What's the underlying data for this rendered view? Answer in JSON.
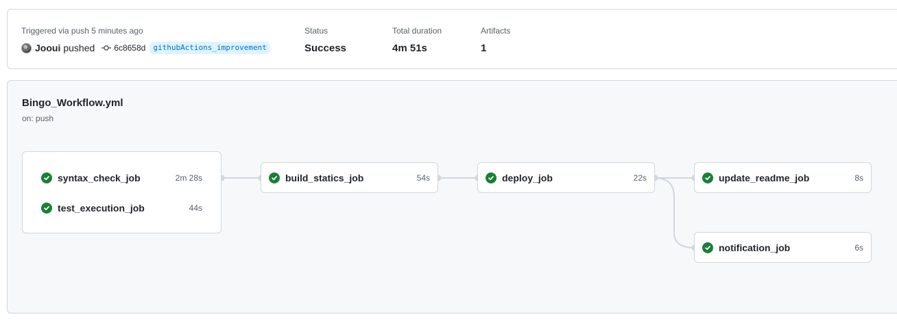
{
  "summary": {
    "trigger_text": "Triggered via push 5 minutes ago",
    "actor": "Jooui",
    "action": "pushed",
    "commit_sha": "6c8658d",
    "branch": "githubActions_improvement",
    "status_label": "Status",
    "status_value": "Success",
    "duration_label": "Total duration",
    "duration_value": "4m 51s",
    "artifacts_label": "Artifacts",
    "artifacts_value": "1"
  },
  "workflow": {
    "title": "Bingo_Workflow.yml",
    "trigger": "on: push",
    "jobs": {
      "syntax_check": {
        "name": "syntax_check_job",
        "duration": "2m 28s",
        "status": "success"
      },
      "test_execution": {
        "name": "test_execution_job",
        "duration": "44s",
        "status": "success"
      },
      "build_statics": {
        "name": "build_statics_job",
        "duration": "54s",
        "status": "success"
      },
      "deploy": {
        "name": "deploy_job",
        "duration": "22s",
        "status": "success"
      },
      "update_readme": {
        "name": "update_readme_job",
        "duration": "8s",
        "status": "success"
      },
      "notification": {
        "name": "notification_job",
        "duration": "6s",
        "status": "success"
      }
    }
  },
  "colors": {
    "success": "#1a7f37",
    "link": "#0969da",
    "connector": "#d0d7de"
  }
}
